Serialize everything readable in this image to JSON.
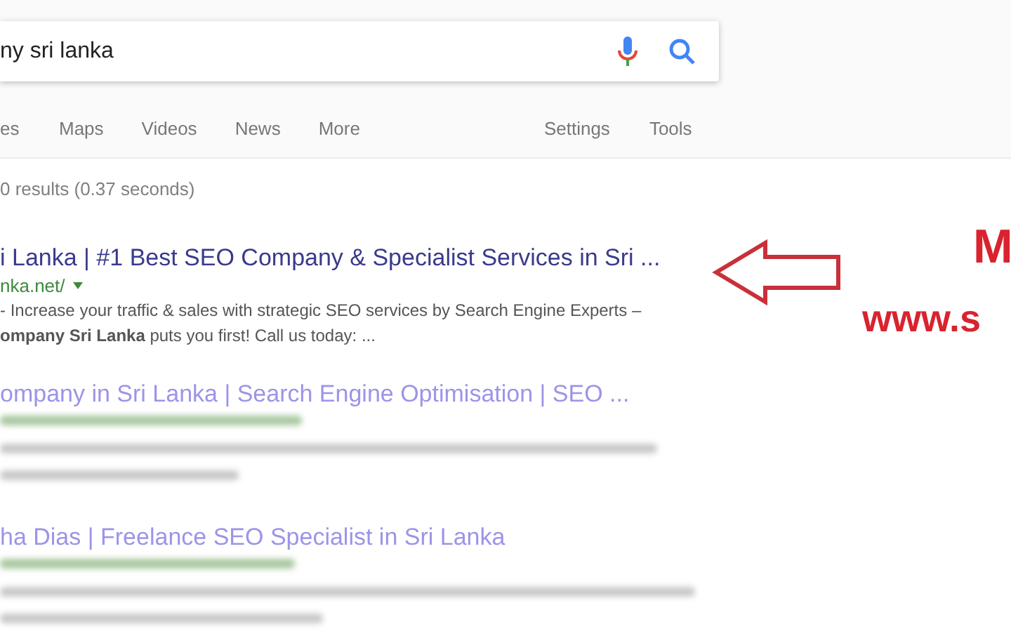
{
  "search": {
    "value": "ny sri lanka"
  },
  "tabs": [
    {
      "label": "es"
    },
    {
      "label": "Maps"
    },
    {
      "label": "Videos"
    },
    {
      "label": "News"
    },
    {
      "label": "More"
    }
  ],
  "tools": [
    {
      "label": "Settings"
    },
    {
      "label": "Tools"
    }
  ],
  "result_stats": "0 results (0.37 seconds)",
  "results": [
    {
      "title": "i Lanka | #1 Best SEO Company & Specialist Services in Sri ...",
      "url": "nka.net/",
      "snippet": [
        "- Increase your traffic & sales with strategic SEO services by Search Engine Experts –",
        "**ompany Sri Lanka** puts you first! Call us today: ..."
      ],
      "kind": "clear"
    },
    {
      "title": "ompany in Sri Lanka | Search Engine Optimisation | SEO ...",
      "kind": "faded"
    },
    {
      "title": "ha Dias | Freelance SEO Specialist in Sri Lanka",
      "kind": "faded"
    }
  ],
  "annotation": {
    "heading": "M",
    "website": "www.s"
  }
}
